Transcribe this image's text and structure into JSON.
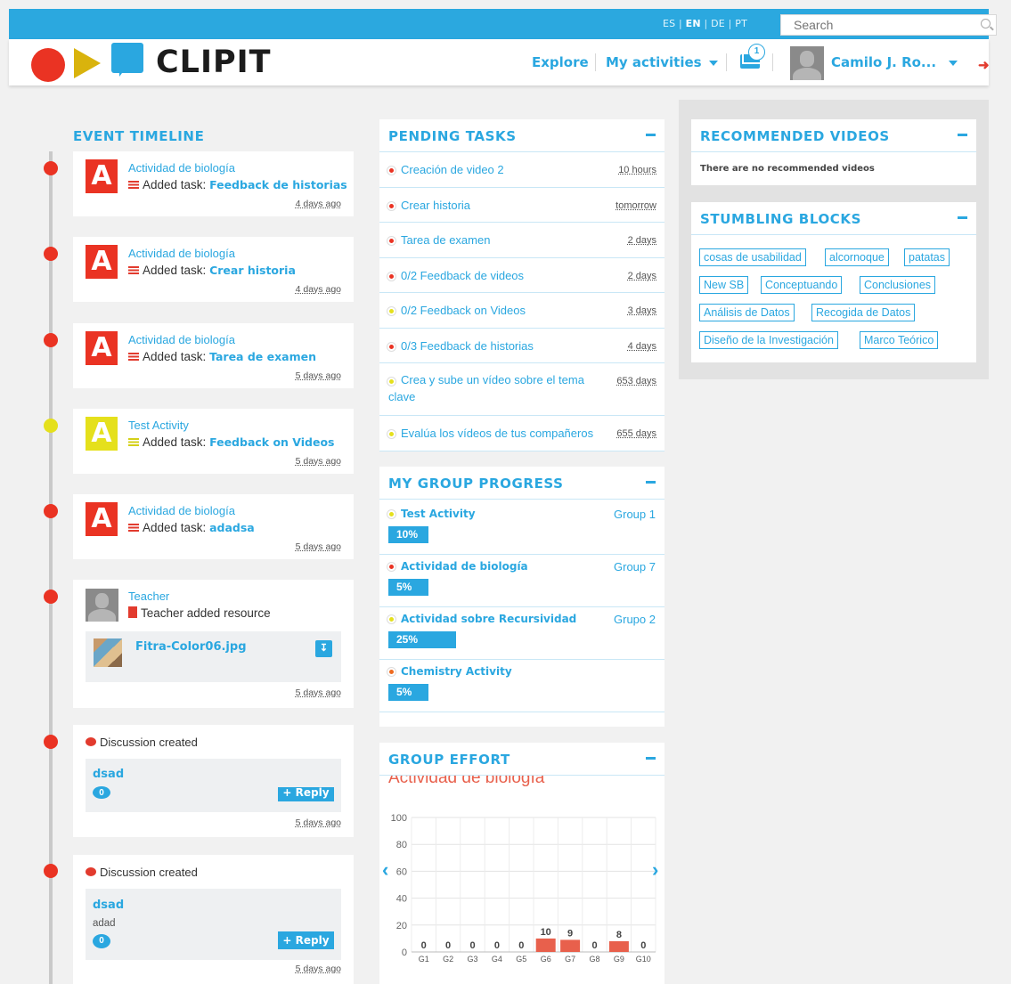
{
  "topbar": {
    "langs": [
      "ES",
      "EN",
      "DE",
      "PT"
    ],
    "search_placeholder": "Search"
  },
  "header": {
    "logo_text": "CLIPIT",
    "explore": "Explore",
    "my_activities": "My activities",
    "messages_count": "1",
    "user_name": "Camilo J. Ro..."
  },
  "timeline": {
    "title": "EVENT TIMELINE",
    "events": [
      {
        "activity": "Actividad de biología",
        "prefix": "Added task:",
        "task": "Feedback de historias",
        "ago": "4 days ago",
        "color": "#ea3323"
      },
      {
        "activity": "Actividad de biología",
        "prefix": "Added task:",
        "task": "Crear historia",
        "ago": "4 days ago",
        "color": "#ea3323"
      },
      {
        "activity": "Actividad de biología",
        "prefix": "Added task:",
        "task": "Tarea de examen",
        "ago": "5 days ago",
        "color": "#ea3323"
      },
      {
        "activity": "Test Activity",
        "prefix": "Added task:",
        "task": "Feedback on Videos",
        "ago": "5 days ago",
        "color": "#e5e01c"
      },
      {
        "activity": "Actividad de biología",
        "prefix": "Added task:",
        "task": "adadsa",
        "ago": "5 days ago",
        "color": "#ea3323"
      }
    ],
    "activity_icon_letter": "A",
    "resource": {
      "user": "Teacher",
      "text": "Teacher added resource",
      "file": "Fitra-Color06.jpg",
      "ago": "5 days ago"
    },
    "discussions": [
      {
        "text": "Discussion created",
        "title": "dsad",
        "body": "",
        "count": "0",
        "reply": "+ Reply",
        "ago": "5 days ago"
      },
      {
        "text": "Discussion created",
        "title": "dsad",
        "body": "adad",
        "count": "0",
        "reply": "+ Reply",
        "ago": "5 days ago"
      }
    ]
  },
  "pending": {
    "title": "PENDING TASKS",
    "tasks": [
      {
        "name": "Creación de video 2",
        "due": "10 hours",
        "color": "#ea3323"
      },
      {
        "name": "Crear historia",
        "due": "tomorrow",
        "color": "#ea3323"
      },
      {
        "name": "Tarea de examen",
        "due": "2 days",
        "color": "#ea3323"
      },
      {
        "name": "0/2 Feedback de videos",
        "due": "2 days",
        "color": "#ea3323"
      },
      {
        "name": "0/2 Feedback on Videos",
        "due": "3 days",
        "color": "#e5e01c"
      },
      {
        "name": "0/3 Feedback de historias",
        "due": "4 days",
        "color": "#ea3323"
      },
      {
        "name": "Crea y sube un vídeo sobre el tema clave",
        "due": "653 days",
        "color": "#e5e01c"
      },
      {
        "name": "Evalúa los vídeos de tus compañeros",
        "due": "655 days",
        "color": "#e5e01c"
      }
    ]
  },
  "group_progress": {
    "title": "MY GROUP PROGRESS",
    "rows": [
      {
        "activity": "Test Activity",
        "group": "Group 1",
        "percent": 10,
        "label": "10%",
        "color": "#e5e01c"
      },
      {
        "activity": "Actividad de biología",
        "group": "Group 7",
        "percent": 5,
        "label": "5%",
        "color": "#ea3323"
      },
      {
        "activity": "Actividad sobre Recursividad",
        "group": "Grupo 2",
        "percent": 25,
        "label": "25%",
        "color": "#e5e01c"
      },
      {
        "activity": "Chemistry Activity",
        "group": "",
        "percent": 5,
        "label": "5%",
        "color": "#ee6a1f"
      }
    ]
  },
  "group_effort": {
    "title": "GROUP EFFORT",
    "chart_title": "Actividad de biología"
  },
  "chart_data": {
    "type": "bar",
    "title": "Actividad de biología",
    "categories": [
      "G1",
      "G2",
      "G3",
      "G4",
      "G5",
      "G6",
      "G7",
      "G8",
      "G9",
      "G10"
    ],
    "values": [
      0,
      0,
      0,
      0,
      0,
      10,
      9,
      0,
      8,
      0
    ],
    "yticks": [
      0,
      20,
      40,
      60,
      80,
      100
    ],
    "ylim": [
      0,
      100
    ],
    "bar_color": "#e8604c",
    "grid": true
  },
  "recommended": {
    "title": "RECOMMENDED VIDEOS",
    "empty_text": "There are no recommended videos"
  },
  "stumbling": {
    "title": "STUMBLING BLOCKS",
    "tags": [
      "cosas de usabilidad",
      "alcornoque",
      "patatas",
      "New SB",
      "Conceptuando",
      "Conclusiones",
      "Análisis de Datos",
      "Recogida de Datos",
      "Diseño de la Investigación",
      "Marco Teórico"
    ]
  },
  "colors": {
    "accent": "#2aa7e0",
    "red": "#ea3323",
    "yellow": "#e5e01c"
  }
}
